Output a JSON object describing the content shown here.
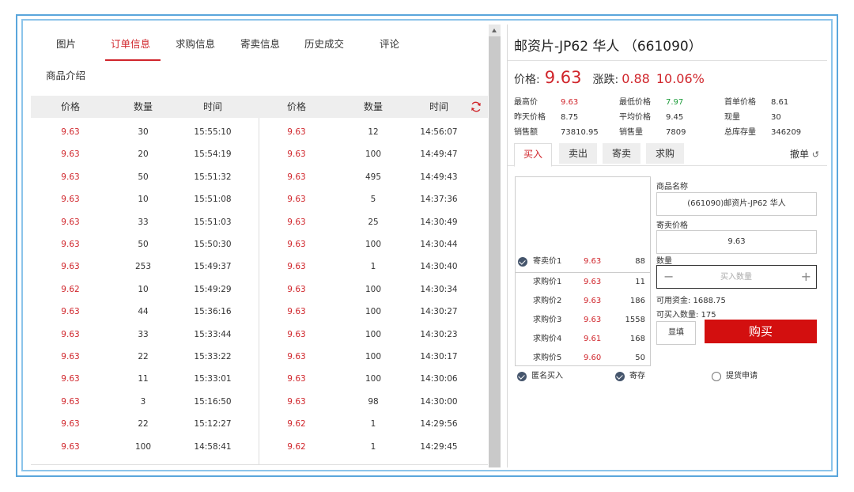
{
  "tabs": [
    {
      "label": "图片"
    },
    {
      "label": "订单信息"
    },
    {
      "label": "求购信息"
    },
    {
      "label": "寄卖信息"
    },
    {
      "label": "历史成交"
    },
    {
      "label": "评论"
    },
    {
      "label": "商品介绍"
    }
  ],
  "orders": {
    "headers": [
      "价格",
      "数量",
      "时间",
      "价格",
      "数量",
      "时间"
    ],
    "left": [
      {
        "price": "9.63",
        "qty": "30",
        "time": "15:55:10"
      },
      {
        "price": "9.63",
        "qty": "20",
        "time": "15:54:19"
      },
      {
        "price": "9.63",
        "qty": "50",
        "time": "15:51:32"
      },
      {
        "price": "9.63",
        "qty": "10",
        "time": "15:51:08"
      },
      {
        "price": "9.63",
        "qty": "33",
        "time": "15:51:03"
      },
      {
        "price": "9.63",
        "qty": "50",
        "time": "15:50:30"
      },
      {
        "price": "9.63",
        "qty": "253",
        "time": "15:49:37"
      },
      {
        "price": "9.62",
        "qty": "10",
        "time": "15:49:29"
      },
      {
        "price": "9.63",
        "qty": "44",
        "time": "15:36:16"
      },
      {
        "price": "9.63",
        "qty": "33",
        "time": "15:33:44"
      },
      {
        "price": "9.63",
        "qty": "22",
        "time": "15:33:22"
      },
      {
        "price": "9.63",
        "qty": "11",
        "time": "15:33:01"
      },
      {
        "price": "9.63",
        "qty": "3",
        "time": "15:16:50"
      },
      {
        "price": "9.63",
        "qty": "22",
        "time": "15:12:27"
      },
      {
        "price": "9.63",
        "qty": "100",
        "time": "14:58:41"
      }
    ],
    "right": [
      {
        "price": "9.63",
        "qty": "12",
        "time": "14:56:07"
      },
      {
        "price": "9.63",
        "qty": "100",
        "time": "14:49:47"
      },
      {
        "price": "9.63",
        "qty": "495",
        "time": "14:49:43"
      },
      {
        "price": "9.63",
        "qty": "5",
        "time": "14:37:36"
      },
      {
        "price": "9.63",
        "qty": "25",
        "time": "14:30:49"
      },
      {
        "price": "9.63",
        "qty": "100",
        "time": "14:30:44"
      },
      {
        "price": "9.63",
        "qty": "1",
        "time": "14:30:40"
      },
      {
        "price": "9.63",
        "qty": "100",
        "time": "14:30:34"
      },
      {
        "price": "9.63",
        "qty": "100",
        "time": "14:30:27"
      },
      {
        "price": "9.63",
        "qty": "100",
        "time": "14:30:23"
      },
      {
        "price": "9.63",
        "qty": "100",
        "time": "14:30:17"
      },
      {
        "price": "9.63",
        "qty": "100",
        "time": "14:30:06"
      },
      {
        "price": "9.63",
        "qty": "98",
        "time": "14:30:00"
      },
      {
        "price": "9.62",
        "qty": "1",
        "time": "14:29:56"
      },
      {
        "price": "9.62",
        "qty": "1",
        "time": "14:29:45"
      }
    ]
  },
  "product": {
    "title": "邮资片-JP62 华人 （661090）",
    "price_label": "价格:",
    "price": "9.63",
    "change_label": "涨跌:",
    "change": "0.88",
    "change_pct": "10.06%",
    "stats": [
      {
        "label": "最高价",
        "value": "9.63",
        "color": "red"
      },
      {
        "label": "最低价格",
        "value": "7.97",
        "color": "green"
      },
      {
        "label": "首单价格",
        "value": "8.61",
        "color": "normal"
      },
      {
        "label": "昨天价格",
        "value": "8.75",
        "color": "normal"
      },
      {
        "label": "平均价格",
        "value": "9.45",
        "color": "normal"
      },
      {
        "label": "现量",
        "value": "30",
        "color": "normal"
      },
      {
        "label": "销售额",
        "value": "73810.95",
        "color": "normal"
      },
      {
        "label": "销售量",
        "value": "7809",
        "color": "normal"
      },
      {
        "label": "总库存量",
        "value": "346209",
        "color": "normal"
      }
    ]
  },
  "trade": {
    "tabs": [
      "买入",
      "卖出",
      "寄卖",
      "求购"
    ],
    "cancel": "撤单",
    "depth": [
      {
        "label": "寄卖价1",
        "price": "9.63",
        "qty": "88"
      },
      {
        "label": "求购价1",
        "price": "9.63",
        "qty": "11"
      },
      {
        "label": "求购价2",
        "price": "9.63",
        "qty": "186"
      },
      {
        "label": "求购价3",
        "price": "9.63",
        "qty": "1558"
      },
      {
        "label": "求购价4",
        "price": "9.61",
        "qty": "168"
      },
      {
        "label": "求购价5",
        "price": "9.60",
        "qty": "50"
      }
    ],
    "name_label": "商品名称",
    "name_value": "(661090)邮资片-JP62 华人",
    "price_label": "寄卖价格",
    "price_value": "9.63",
    "qty_label": "数量",
    "qty_placeholder": "买入数量",
    "funds": "可用资金: 1688.75",
    "buyable": "可买入数量: 175",
    "fill_btn": "显填",
    "buy_btn": "购买",
    "options": [
      {
        "label": "匿名买入",
        "checked": true
      },
      {
        "label": "寄存",
        "checked": true
      },
      {
        "label": "提货申请",
        "checked": false
      }
    ]
  }
}
